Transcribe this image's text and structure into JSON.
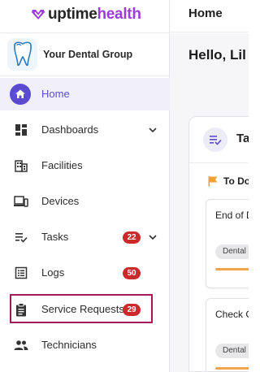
{
  "app": {
    "brand_part1": "uptime",
    "brand_part2": "health",
    "organization": "Your Dental Group"
  },
  "sidebar": {
    "items": [
      {
        "label": "Home",
        "icon": "home-icon",
        "active": true
      },
      {
        "label": "Dashboards",
        "icon": "dashboard-icon",
        "expandable": true
      },
      {
        "label": "Facilities",
        "icon": "building-icon"
      },
      {
        "label": "Devices",
        "icon": "devices-icon"
      },
      {
        "label": "Tasks",
        "icon": "tasks-icon",
        "badge": "22",
        "expandable": true
      },
      {
        "label": "Logs",
        "icon": "logs-icon",
        "badge": "50"
      },
      {
        "label": "Service Requests",
        "icon": "clipboard-icon",
        "badge": "29",
        "highlighted": true
      },
      {
        "label": "Technicians",
        "icon": "people-icon"
      }
    ]
  },
  "header": {
    "title": "Home"
  },
  "main": {
    "greeting": "Hello, Lil",
    "card_title": "Ta",
    "todo_label": "To Do",
    "tasks": [
      {
        "title": "End of D",
        "chip": "Dental"
      },
      {
        "title": "Check C",
        "chip": "Dental"
      }
    ]
  },
  "colors": {
    "accent": "#5b4ccf",
    "brand_accent": "#9b3dd6",
    "badge": "#cc2a2a",
    "highlight_border": "#a3195b",
    "progress": "#f2a54a",
    "flag": "#f2a03a"
  }
}
